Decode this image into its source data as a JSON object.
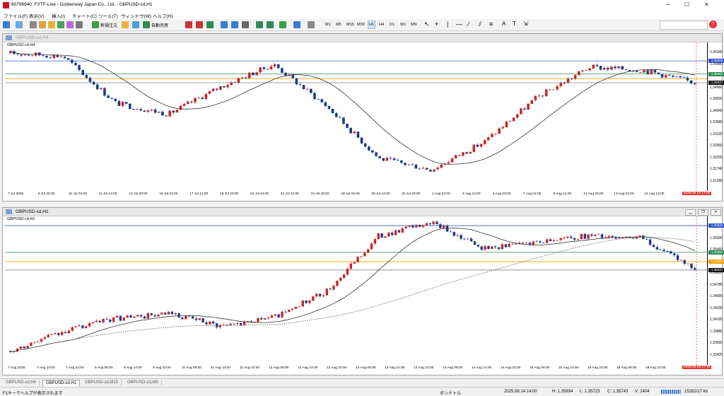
{
  "window": {
    "title": "60796940: FXTF-Live - Goldenway Japan Co., Ltd. - GBPUSD-cd,H1"
  },
  "menu": [
    "ファイル(F)",
    "表示(V)",
    "挿入(I)",
    "チャート(C)",
    "ツール(T)",
    "ウィンドウ(W)",
    "ヘルプ(H)"
  ],
  "toolbar": {
    "new_order": "新規注文",
    "auto_trading": "自動売買",
    "timeframes": [
      "M1",
      "M5",
      "M15",
      "M30",
      "H1",
      "H4",
      "D1",
      "W1",
      "MN"
    ],
    "active_timeframe": "H1"
  },
  "charts": [
    {
      "window_title": "GBPUSD-cd,H4",
      "label": "GBPUSD-cd,H4",
      "price_levels": [
        "1.36340",
        "1.35880",
        "1.35420",
        "1.34960",
        "1.34500",
        "1.34040",
        "1.33580",
        "1.33120",
        "1.32660",
        "1.32200",
        "1.31740",
        "1.31280"
      ],
      "tags": [
        {
          "text": "1.35826",
          "color": "#3355cc"
        },
        {
          "text": "1.35352",
          "color": "#2e8b57"
        },
        {
          "text": "1.35037",
          "color": "#111111"
        }
      ],
      "time_labels": [
        "7 Jul 2025",
        "8 Jul 20:00",
        "10 Jul 04:00",
        "11 Jul 12:00",
        "14 Jul 20:00",
        "16 Jul 04:00",
        "17 Jul 12:00",
        "18 Jul 20:00",
        "22 Jul 04:00",
        "23 Jul 12:00",
        "24 Jul 20:00",
        "28 Jul 04:00",
        "29 Jul 12:00",
        "30 Jul 20:00",
        "1 Aug 04:00",
        "4 Aug 12:00",
        "5 Aug 20:00",
        "7 Aug 04:00",
        "8 Aug 12:00",
        "11 Aug 20:00",
        "13 Aug 04:00",
        "14 Aug 12:00"
      ],
      "highlight_time": "2025.08.18 17:00"
    },
    {
      "window_title": "GBPUSD-cd,H1",
      "label": "GBPUSD-cd,H1",
      "price_levels": [
        "1.35915",
        "1.35690",
        "1.35460",
        "1.35235",
        "1.35010",
        "1.34785",
        "1.34555",
        "1.34330",
        "1.34105",
        "1.33880",
        "1.33650",
        "1.33425"
      ],
      "tags": [
        {
          "text": "1.35826",
          "color": "#3355cc"
        },
        {
          "text": "1.35352",
          "color": "#2e8b57"
        },
        {
          "text": "1.35185",
          "color": "#f0a000"
        },
        {
          "text": "1.35037",
          "color": "#111111"
        }
      ],
      "time_labels": [
        "7 Aug 2025",
        "7 Aug 14:00",
        "7 Aug 22:00",
        "8 Aug 06:00",
        "8 Aug 14:00",
        "8 Aug 22:00",
        "11 Aug 06:00",
        "11 Aug 14:00",
        "11 Aug 22:00",
        "12 Aug 06:00",
        "12 Aug 14:00",
        "12 Aug 22:00",
        "13 Aug 06:00",
        "13 Aug 14:00",
        "13 Aug 22:00",
        "14 Aug 06:00",
        "14 Aug 14:00",
        "14 Aug 22:00",
        "15 Aug 06:00",
        "15 Aug 14:00",
        "15 Aug 22:00",
        "18 Aug 06:00",
        "18 Aug 22:00"
      ],
      "highlight_time": "2025.08.18 17:15"
    }
  ],
  "tabs": [
    "GBPUSD-cd,H4",
    "GBPUSD-cd,H1",
    "GBPUSD-cd,M15",
    "GBPUSD-cd,M5"
  ],
  "active_tab": "GBPUSD-cd,H1",
  "status": {
    "help": "F1キーでヘルプが表示されます",
    "profile": "ボンドトル",
    "time": "2025.08.14 14:00",
    "high": "H: 1.35834",
    "low": "L: 1.35723",
    "close": "C: 1.35743",
    "volume": "V: 2404",
    "traffic": "15282/17 kb"
  },
  "colors": {
    "bull": "#c62828",
    "bear": "#1e3a8a",
    "ma_fast": "#333333",
    "ma_slow": "#555555",
    "line_blue": "#3355cc",
    "line_green": "#2e8b57",
    "line_orange": "#f0a000",
    "line_gray": "#888888",
    "vline": "#e53935"
  },
  "chart_data": [
    {
      "type": "candlestick",
      "symbol": "GBPUSD-cd,H4",
      "x_range": [
        "7 Jul 2025",
        "18 Aug 2025 17:00"
      ],
      "ylim": [
        1.3128,
        1.3634
      ],
      "horizontal_lines": [
        {
          "value": 1.35826,
          "color": "blue"
        },
        {
          "value": 1.35352,
          "color": "green"
        },
        {
          "value": 1.35185,
          "color": "orange"
        },
        {
          "value": 1.35037,
          "color": "gray"
        }
      ],
      "key_points": [
        {
          "x": "7 Jul 2025",
          "y": 1.361
        },
        {
          "x": "10 Jul 04:00",
          "y": 1.36
        },
        {
          "x": "14 Jul 20:00",
          "y": 1.343
        },
        {
          "x": "16 Jul 04:00",
          "y": 1.339
        },
        {
          "x": "22 Jul 04:00",
          "y": 1.349
        },
        {
          "x": "23 Jul 12:00",
          "y": 1.357
        },
        {
          "x": "28 Jul 04:00",
          "y": 1.342
        },
        {
          "x": "30 Jul 20:00",
          "y": 1.323
        },
        {
          "x": "1 Aug 04:00",
          "y": 1.319
        },
        {
          "x": "5 Aug 20:00",
          "y": 1.329
        },
        {
          "x": "11 Aug 20:00",
          "y": 1.345
        },
        {
          "x": "13 Aug 04:00",
          "y": 1.356
        },
        {
          "x": "14 Aug 12:00",
          "y": 1.355
        },
        {
          "x": "18 Aug 17:00",
          "y": 1.3504
        }
      ]
    },
    {
      "type": "candlestick",
      "symbol": "GBPUSD-cd,H1",
      "x_range": [
        "7 Aug 2025",
        "18 Aug 22:00"
      ],
      "ylim": [
        1.33425,
        1.35915
      ],
      "horizontal_lines": [
        {
          "value": 1.35826,
          "color": "blue"
        },
        {
          "value": 1.35352,
          "color": "green"
        },
        {
          "value": 1.35185,
          "color": "orange"
        },
        {
          "value": 1.35037,
          "color": "gray"
        }
      ],
      "key_points": [
        {
          "x": "7 Aug 2025",
          "y": 1.336
        },
        {
          "x": "7 Aug 14:00",
          "y": 1.3395
        },
        {
          "x": "8 Aug 14:00",
          "y": 1.3418
        },
        {
          "x": "11 Aug 06:00",
          "y": 1.3425
        },
        {
          "x": "11 Aug 14:00",
          "y": 1.3405
        },
        {
          "x": "12 Aug 06:00",
          "y": 1.342
        },
        {
          "x": "12 Aug 14:00",
          "y": 1.3465
        },
        {
          "x": "13 Aug 06:00",
          "y": 1.3565
        },
        {
          "x": "13 Aug 22:00",
          "y": 1.3588
        },
        {
          "x": "14 Aug 14:00",
          "y": 1.3542
        },
        {
          "x": "15 Aug 06:00",
          "y": 1.3555
        },
        {
          "x": "15 Aug 22:00",
          "y": 1.3565
        },
        {
          "x": "18 Aug 06:00",
          "y": 1.356
        },
        {
          "x": "18 Aug 17:15",
          "y": 1.3504
        }
      ]
    }
  ]
}
